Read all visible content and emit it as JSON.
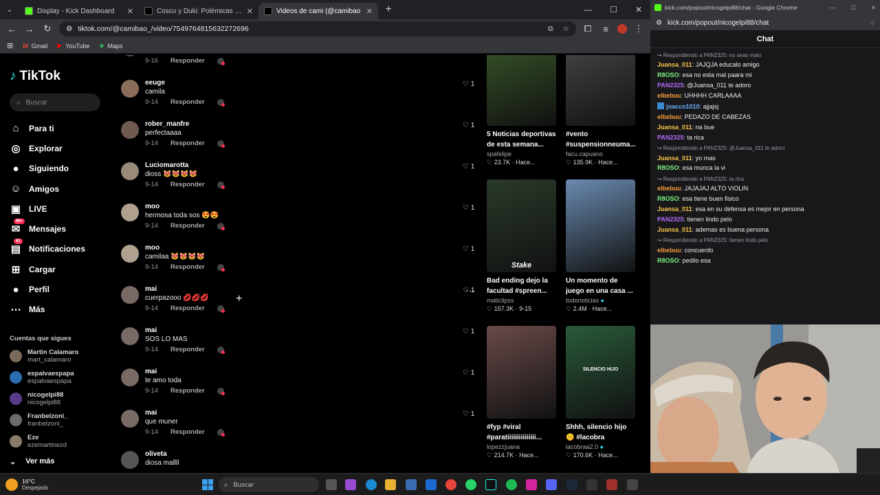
{
  "browser": {
    "tabs": [
      {
        "title": "Display - Kick Dashboard",
        "icon": "kick-icon",
        "color": "#53fc18"
      },
      {
        "title": "Coscu y Duki: Polémicas y Resp",
        "icon": "tiktok-icon",
        "color": "#000000"
      },
      {
        "title": "Videos de cami (@camibao",
        "icon": "tiktok-icon",
        "color": "#000000",
        "active": true
      }
    ],
    "url": "tiktok.com/@camibao_/video/7549764815632272696",
    "bookmarks": [
      "Gmail",
      "YouTube",
      "Maps"
    ]
  },
  "sidebar": {
    "logo": "TikTok",
    "search_placeholder": "Buscar",
    "nav": [
      {
        "label": "Para ti",
        "icon": "home-icon"
      },
      {
        "label": "Explorar",
        "icon": "compass-icon"
      },
      {
        "label": "Siguiendo",
        "icon": "following-avatar-icon"
      },
      {
        "label": "Amigos",
        "icon": "friends-icon"
      },
      {
        "label": "LIVE",
        "icon": "live-icon"
      },
      {
        "label": "Mensajes",
        "icon": "messages-icon",
        "badge": "99+"
      },
      {
        "label": "Notificaciones",
        "icon": "notifications-icon",
        "badge": "61"
      },
      {
        "label": "Cargar",
        "icon": "upload-icon"
      },
      {
        "label": "Perfil",
        "icon": "profile-icon"
      },
      {
        "label": "Más",
        "icon": "more-icon"
      }
    ],
    "following_title": "Cuentas que sigues",
    "following": [
      {
        "name": "Martin Calamaro",
        "handle": "mart_calamaro",
        "color": "#7a6a5a"
      },
      {
        "name": "espalvaespapa",
        "handle": "espalvaespapa",
        "color": "#2a6db0"
      },
      {
        "name": "nicogelpi88",
        "handle": "nicogelpi88",
        "color": "#5a3a8a"
      },
      {
        "name": "Franbelzoni_",
        "handle": "franbelzoni_",
        "color": "#6a6a6a"
      },
      {
        "name": "Eze",
        "handle": "ezemartinezd",
        "color": "#8a7a6a"
      }
    ],
    "see_more": "Ver más"
  },
  "comments": [
    {
      "user": "",
      "text": "",
      "date": "9-16",
      "reply": "Responder",
      "likes": "1",
      "color": "#555"
    },
    {
      "user": "eeuge",
      "text": "camila",
      "date": "9-14",
      "reply": "Responder",
      "likes": "1",
      "color": "#8a6d5a"
    },
    {
      "user": "rober_manfre",
      "text": "perfectaaaa",
      "date": "9-14",
      "reply": "Responder",
      "likes": "1",
      "color": "#6e5a4e"
    },
    {
      "user": "Luciomarotta",
      "text": "dioss 😻😻😻😻",
      "date": "9-14",
      "reply": "Responder",
      "likes": "1",
      "color": "#9a8a7a"
    },
    {
      "user": "moo",
      "text": "hermosa toda sos 😍😍",
      "date": "9-14",
      "reply": "Responder",
      "likes": "1",
      "color": "#b0a090"
    },
    {
      "user": "moo",
      "text": "camilaa 😻😻😻😻",
      "date": "9-14",
      "reply": "Responder",
      "likes": "1",
      "color": "#b0a090"
    },
    {
      "user": "mai",
      "text": "cuerpazooo 💋💋💋",
      "date": "9-14",
      "reply": "Responder",
      "likes": "1",
      "color": "#7a6a66"
    },
    {
      "user": "mai",
      "text": "SOS LO MAS",
      "date": "9-14",
      "reply": "Responder",
      "likes": "1",
      "color": "#7a6a66"
    },
    {
      "user": "mai",
      "text": "te amo toda",
      "date": "9-14",
      "reply": "Responder",
      "likes": "1",
      "color": "#7a6a66"
    },
    {
      "user": "mai",
      "text": "que muner",
      "date": "9-14",
      "reply": "Responder",
      "likes": "1",
      "color": "#7a6a66"
    },
    {
      "user": "oliveta",
      "text": "diosa mallll",
      "date": "",
      "reply": "",
      "likes": "",
      "color": "#555"
    }
  ],
  "videos": [
    {
      "title": "5 Noticias deportivas de esta semana...",
      "author": "spafelipe",
      "views": "23.7K",
      "time": "Hace...",
      "thumb": "#3a5a2a"
    },
    {
      "title": "#vento #suspensionneuma...",
      "author": "facu.capuano",
      "views": "135.9K",
      "time": "Hace...",
      "thumb": "#4a4a4a"
    },
    {
      "title": "Bad ending dejo la facultad #spreen...",
      "author": "maticlipss",
      "views": "157.3K",
      "time": "9-15",
      "thumb": "#2a3a2a",
      "overlay": "Stake"
    },
    {
      "title": "Un momento de juego en una casa ...",
      "author": "todonoticias",
      "views": "2.4M",
      "time": "Hace...",
      "thumb": "#6a8ab0",
      "verified": true
    },
    {
      "title": "#fyp #viral #paratiiiiiiiiiiiiiii...",
      "author": "lopezzjuana",
      "views": "214.7K",
      "time": "Hace...",
      "thumb": "#6a4a4a"
    },
    {
      "title": "Shhh, silencio hijo 🤫 #lacobra",
      "author": "lacobraa2.0",
      "views": "170.6K",
      "time": "Hace...",
      "thumb": "#2a5a3a",
      "verified": true,
      "overlay": "SILENCIO HIJO"
    }
  ],
  "chat": {
    "window_title": "kick.com/popout/nicogelpi88/chat - Google Chrome",
    "url": "kick.com/popout/nicogelpi88/chat",
    "header": "Chat",
    "items": [
      {
        "reply_to": "Respondiendo a PAN2325: no seas malo"
      },
      {
        "user": "Juansa_011",
        "text": "JAJQJA educalo amigo",
        "color": "#f7c64a"
      },
      {
        "user": "R8OSO",
        "text": "esa no esta mal paara mi",
        "color": "#7ef77e"
      },
      {
        "user": "PAN2325",
        "text": "@Juansa_011 te adoro",
        "color": "#b66bf7"
      },
      {
        "user": "elbebuu",
        "text": "UHHHH CARLAAAA",
        "color": "#f79c3a"
      },
      {
        "user": "joacco1010",
        "text": "ajjajsj",
        "color": "#6ab0f7",
        "icon": true
      },
      {
        "user": "elbebuu",
        "text": "PEDAZO DE CABEZAS",
        "color": "#f79c3a"
      },
      {
        "user": "Juansa_011",
        "text": "na bue",
        "color": "#f7c64a"
      },
      {
        "user": "PAN2325",
        "text": "ta rica",
        "color": "#b66bf7"
      },
      {
        "reply_to": "Respondiendo a PAN2325: @Juansa_011 te adoro"
      },
      {
        "user": "Juansa_011",
        "text": "yo mas",
        "color": "#f7c64a"
      },
      {
        "user": "R8OSO",
        "text": "esa munca la vi",
        "color": "#7ef77e"
      },
      {
        "reply_to": "Respondiendo a PAN2325: ta rica"
      },
      {
        "user": "elbebuu",
        "text": "JAJAJAJ ALTO VIOLIN",
        "color": "#f79c3a"
      },
      {
        "user": "R8OSO",
        "text": "esa tiene buen fisico",
        "color": "#7ef77e"
      },
      {
        "user": "Juansa_011",
        "text": "esa en su defensa es mejor en persona",
        "color": "#f7c64a"
      },
      {
        "user": "PAN2325",
        "text": "tienen lindo pelo",
        "color": "#b66bf7"
      },
      {
        "user": "Juansa_011",
        "text": "ademas es buena persona",
        "color": "#f7c64a"
      },
      {
        "reply_to": "Respondiendo a PAN2325: tienen lindo pelo"
      },
      {
        "user": "elbebuu",
        "text": "concuerdo",
        "color": "#f79c3a"
      },
      {
        "user": "R8OSO",
        "text": "pedilo esa",
        "color": "#7ef77e"
      }
    ]
  },
  "taskbar": {
    "temperature": "16°C",
    "weather": "Despejado",
    "search_placeholder": "Buscar"
  }
}
